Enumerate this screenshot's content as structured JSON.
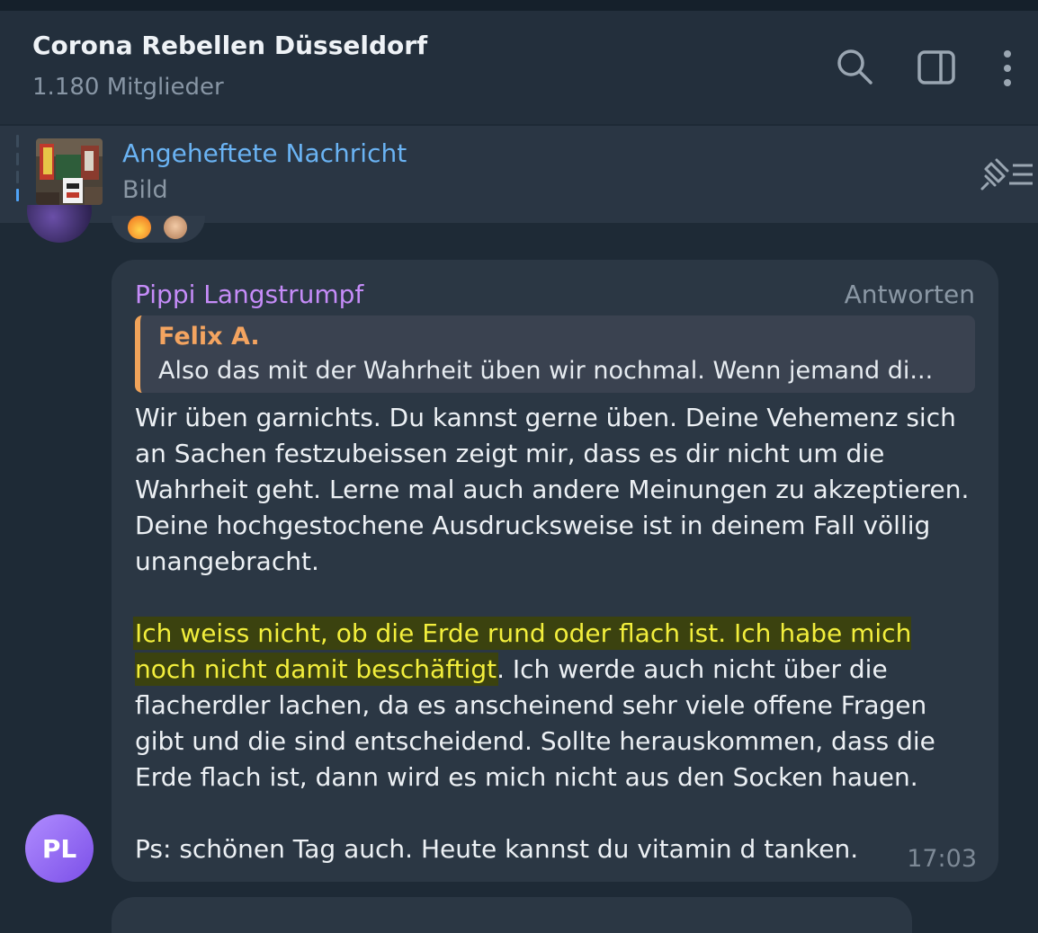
{
  "header": {
    "title": "Corona Rebellen Düsseldorf",
    "subtitle": "1.180 Mitglieder",
    "icons": [
      "search-icon",
      "sidebar-toggle-icon",
      "more-vertical-icon"
    ]
  },
  "pinned": {
    "title": "Angeheftete Nachricht",
    "subtitle": "Bild",
    "icon": "pinned-list-icon"
  },
  "message": {
    "author": "Pippi Langstrumpf",
    "reply_label": "Antworten",
    "quote": {
      "author": "Felix A.",
      "text": "Also das mit der Wahrheit üben wir nochmal. Wenn jemand di..."
    },
    "paragraph1": "Wir üben garnichts. Du kannst gerne üben. Deine Vehemenz sich an Sachen festzubeissen zeigt mir, dass es dir nicht um die Wahrheit geht. Lerne mal auch andere Meinungen zu akzeptieren. Deine hochgestochene Ausdrucksweise ist in deinem Fall völlig unangebracht.",
    "paragraph2_highlight": "Ich weiss nicht, ob die Erde rund oder flach ist. Ich habe mich noch nicht damit beschäftigt",
    "paragraph2_rest": ". Ich werde auch nicht über die flacherdler lachen, da es anscheinend sehr viele offene Fragen gibt und die sind entscheidend. Sollte herauskommen, dass die Erde flach ist, dann wird es mich nicht aus den Socken hauen.",
    "paragraph3": "Ps: schönen Tag auch. Heute kannst du vitamin d tanken.",
    "time": "17:03",
    "avatar_initials": "PL"
  },
  "colors": {
    "author": "#c58cf8",
    "link": "#6ab3f3",
    "quote_accent": "#f0a35a",
    "highlight_text": "#f2ee3c"
  }
}
